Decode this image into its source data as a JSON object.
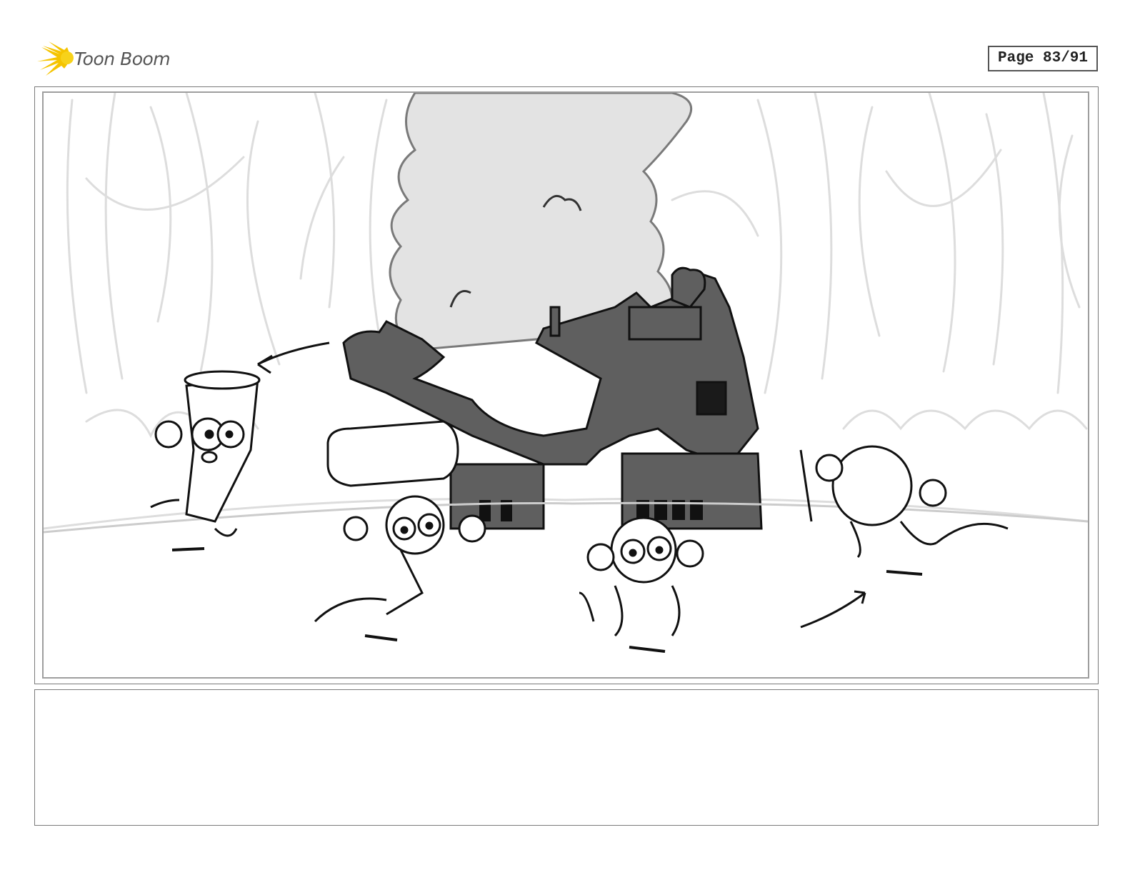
{
  "header": {
    "brand": "Toon Boom",
    "page_label": "Page 83/91"
  },
  "colors": {
    "logo_accent": "#f5c400",
    "frame_border": "#7a7a7a",
    "smoke": "#e3e3e3",
    "wreck": "#5f5f5f",
    "ink": "#111111",
    "background_sketch": "#dddddd"
  },
  "panel": {
    "icon": "storyboard-sketch",
    "caption": ""
  }
}
